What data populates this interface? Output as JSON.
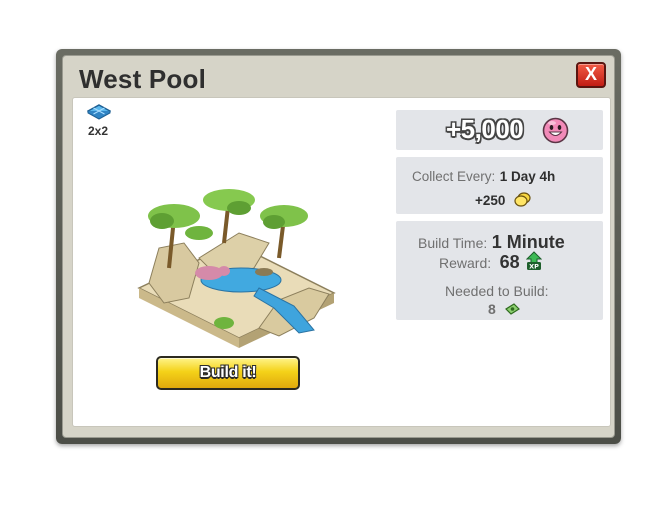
{
  "dialog": {
    "title": "West Pool",
    "close_label": "X"
  },
  "item": {
    "size": "2x2",
    "size_icon": "blue-tile-icon",
    "image": "west-pool-building"
  },
  "build_button": {
    "label": "Build it!"
  },
  "income": {
    "value": "+5,000",
    "icon": "pink-face-currency-icon"
  },
  "collect": {
    "label": "Collect Every:",
    "value": "1 Day 4h",
    "amount": "+250",
    "amount_icon": "gold-coin-icon"
  },
  "build": {
    "time_label": "Build Time:",
    "time_value": "1 Minute",
    "reward_label": "Reward:",
    "reward_value": "68",
    "reward_icon": "xp-icon",
    "xp_badge": "XP",
    "needed_label": "Needed to Build:",
    "needed_value": "8",
    "needed_icon": "green-cash-icon"
  },
  "colors": {
    "frame": "#5a5c54",
    "close_red": "#d8301f",
    "button_yellow": "#f4d219",
    "panel_bg": "#e3e5e9"
  }
}
